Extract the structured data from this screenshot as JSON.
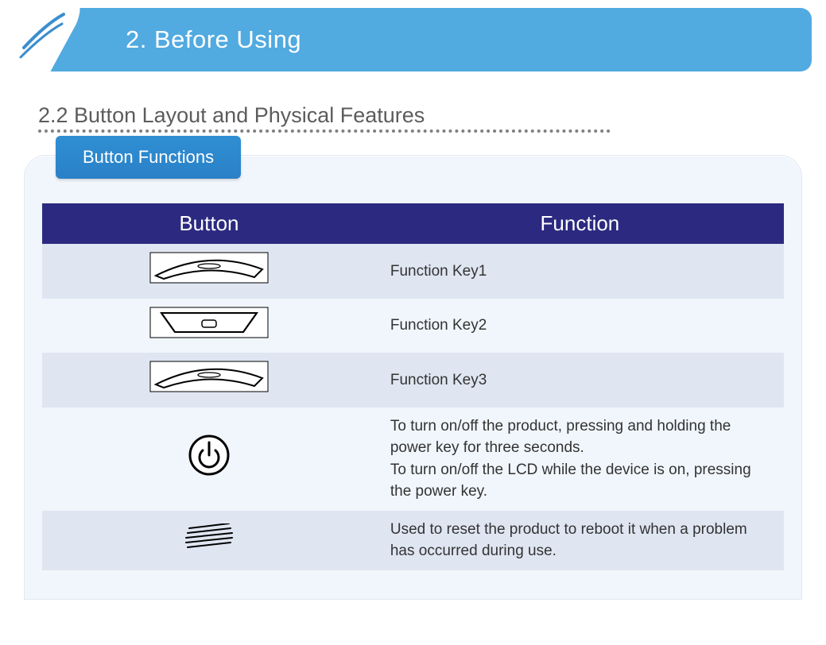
{
  "header": {
    "title": "2. Before Using"
  },
  "section": {
    "title": "2.2 Button Layout and Physical Features"
  },
  "panel": {
    "tab_label": "Button Functions",
    "table": {
      "headers": {
        "col1": "Button",
        "col2": "Function"
      },
      "rows": [
        {
          "icon": "fn1-icon",
          "function": "Function Key1"
        },
        {
          "icon": "fn2-icon",
          "function": "Function Key2"
        },
        {
          "icon": "fn3-icon",
          "function": "Function Key3"
        },
        {
          "icon": "power-icon",
          "function": "To turn on/off the product, pressing and holding the power key for three seconds.\nTo turn on/off the LCD while the device is on, pressing  the power key."
        },
        {
          "icon": "reset-icon",
          "function": "Used to reset the product to reboot it when a problem has occurred during use."
        }
      ]
    }
  }
}
